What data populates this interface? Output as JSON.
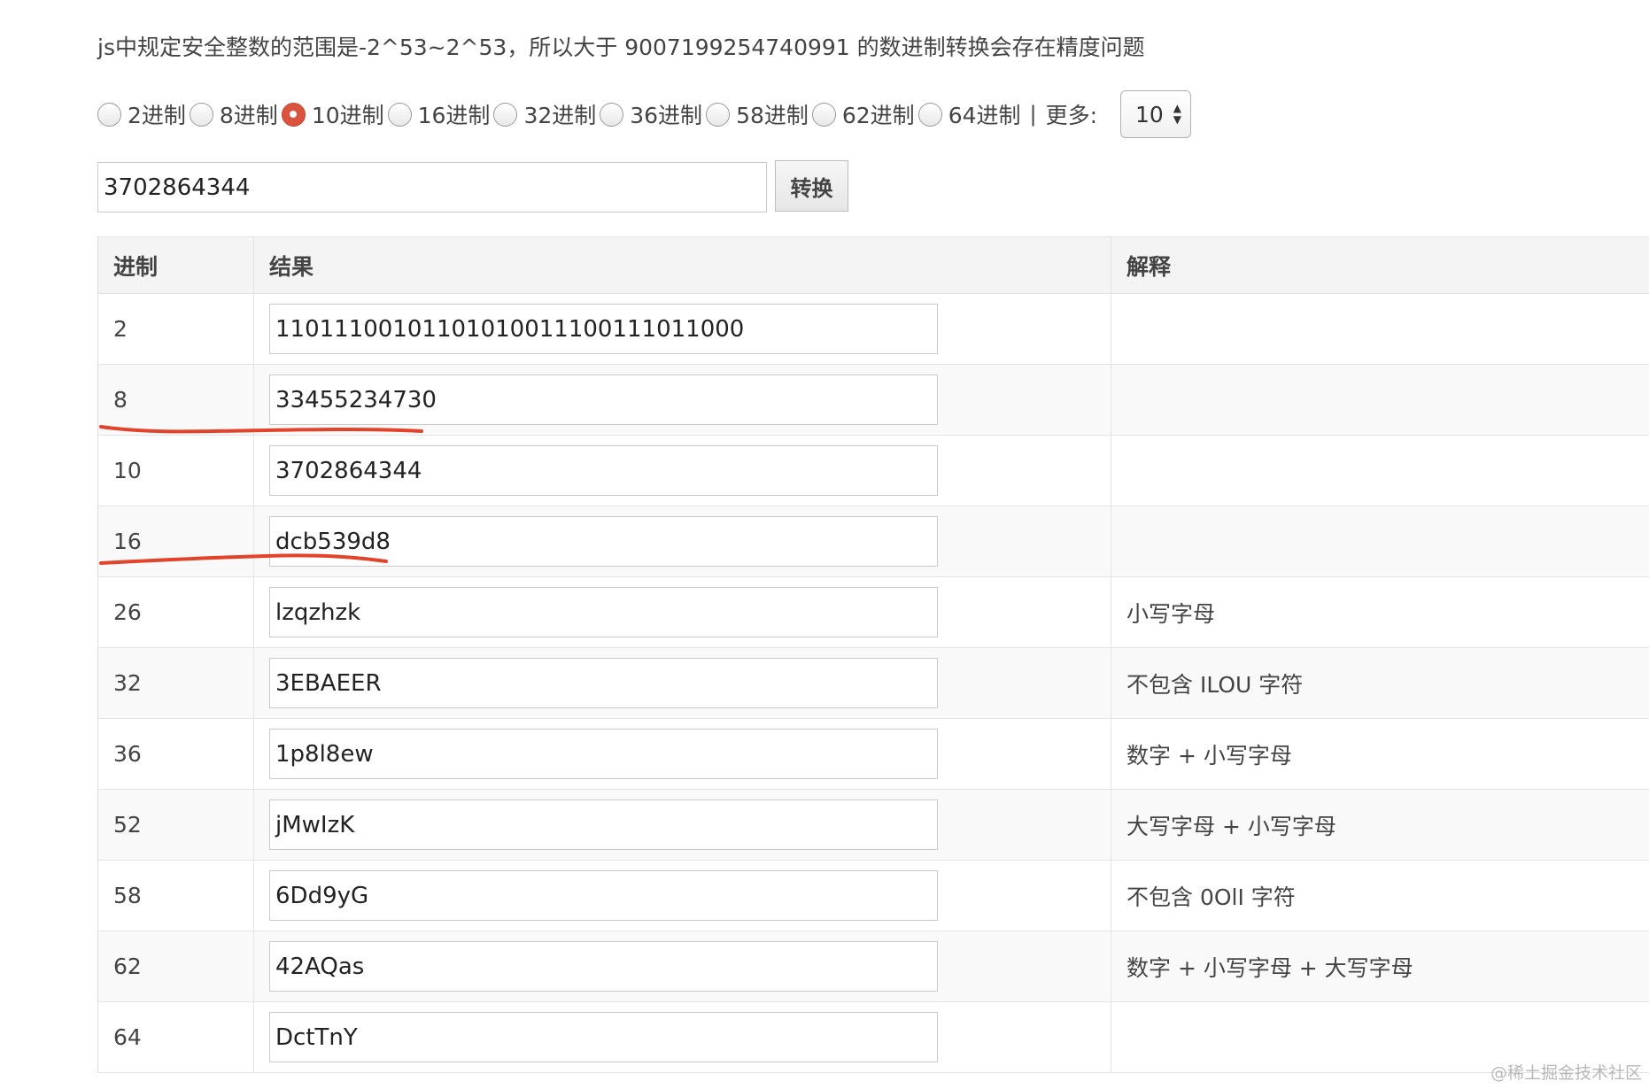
{
  "notice": "js中规定安全整数的范围是-2^53~2^53，所以大于 9007199254740991 的数进制转换会存在精度问题",
  "radix_options": [
    {
      "label": "2进制",
      "checked": false
    },
    {
      "label": "8进制",
      "checked": false
    },
    {
      "label": "10进制",
      "checked": true
    },
    {
      "label": "16进制",
      "checked": false
    },
    {
      "label": "32进制",
      "checked": false
    },
    {
      "label": "36进制",
      "checked": false
    },
    {
      "label": "58进制",
      "checked": false
    },
    {
      "label": "62进制",
      "checked": false
    },
    {
      "label": "64进制",
      "checked": false
    }
  ],
  "separator": "|",
  "more_label": "更多:",
  "more_select_value": "10",
  "input_value": "3702864344",
  "convert_button": "转换",
  "table": {
    "headers": [
      "进制",
      "结果",
      "解释"
    ],
    "rows": [
      {
        "base": "2",
        "result": "11011100101101010011100111011000",
        "note": ""
      },
      {
        "base": "8",
        "result": "33455234730",
        "note": ""
      },
      {
        "base": "10",
        "result": "3702864344",
        "note": ""
      },
      {
        "base": "16",
        "result": "dcb539d8",
        "note": ""
      },
      {
        "base": "26",
        "result": "lzqzhzk",
        "note": "小写字母"
      },
      {
        "base": "32",
        "result": "3EBAEER",
        "note": "不包含 ILOU 字符"
      },
      {
        "base": "36",
        "result": "1p8l8ew",
        "note": "数字 + 小写字母"
      },
      {
        "base": "52",
        "result": "jMwIzK",
        "note": "大写字母 + 小写字母"
      },
      {
        "base": "58",
        "result": "6Dd9yG",
        "note": "不包含 0OlI 字符"
      },
      {
        "base": "62",
        "result": "42AQas",
        "note": "数字 + 小写字母 + 大写字母"
      },
      {
        "base": "64",
        "result": "DctTnY",
        "note": ""
      }
    ]
  },
  "annotation_color": "#e4432b",
  "accent_color": "#d9533e",
  "watermark": "@稀土掘金技术社区"
}
